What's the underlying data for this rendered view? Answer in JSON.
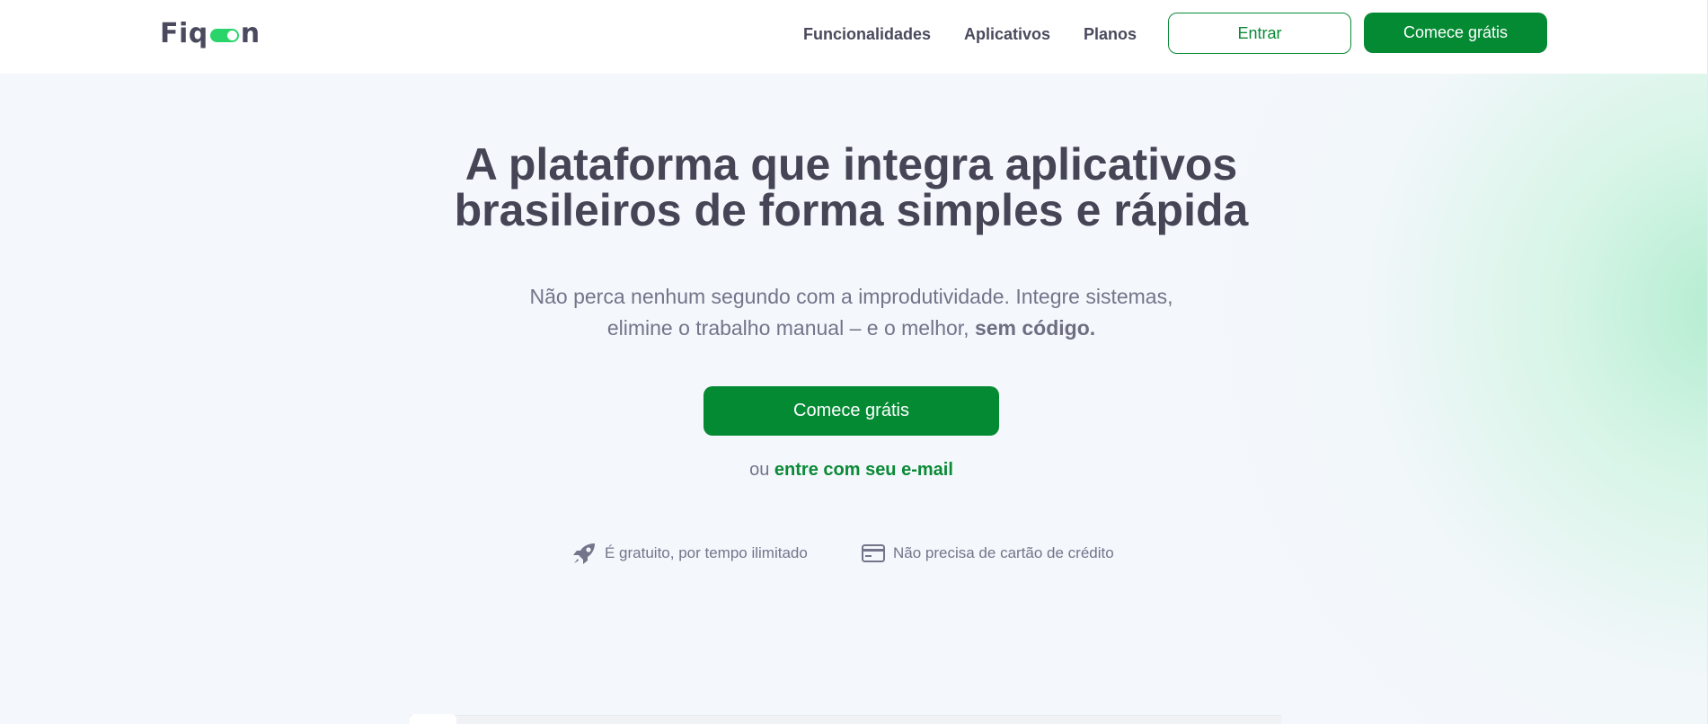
{
  "brand": {
    "logo_prefix": "Fiq",
    "logo_suffix": "n",
    "accent": "#058a34",
    "toggle_color": "#29d46b",
    "text_color": "#454556"
  },
  "nav": {
    "items": [
      {
        "label": "Funcionalidades"
      },
      {
        "label": "Aplicativos"
      },
      {
        "label": "Planos"
      }
    ],
    "login_label": "Entrar",
    "signup_label": "Comece grátis"
  },
  "hero": {
    "title_line1": "A plataforma que integra aplicativos",
    "title_line2": "brasileiros de forma simples e rápida",
    "subtitle_text": "Não perca nenhum segundo com a improdutividade. Integre sistemas, elimine o trabalho manual – e o melhor,",
    "subtitle_bold": "sem código.",
    "cta_label": "Comece grátis",
    "alt_prefix": "ou",
    "alt_link": "entre com seu e-mail"
  },
  "perks": [
    {
      "icon": "rocket-icon",
      "label": "É gratuito, por tempo ilimitado"
    },
    {
      "icon": "credit-card-icon",
      "label": "Não precisa de cartão de crédito"
    }
  ]
}
